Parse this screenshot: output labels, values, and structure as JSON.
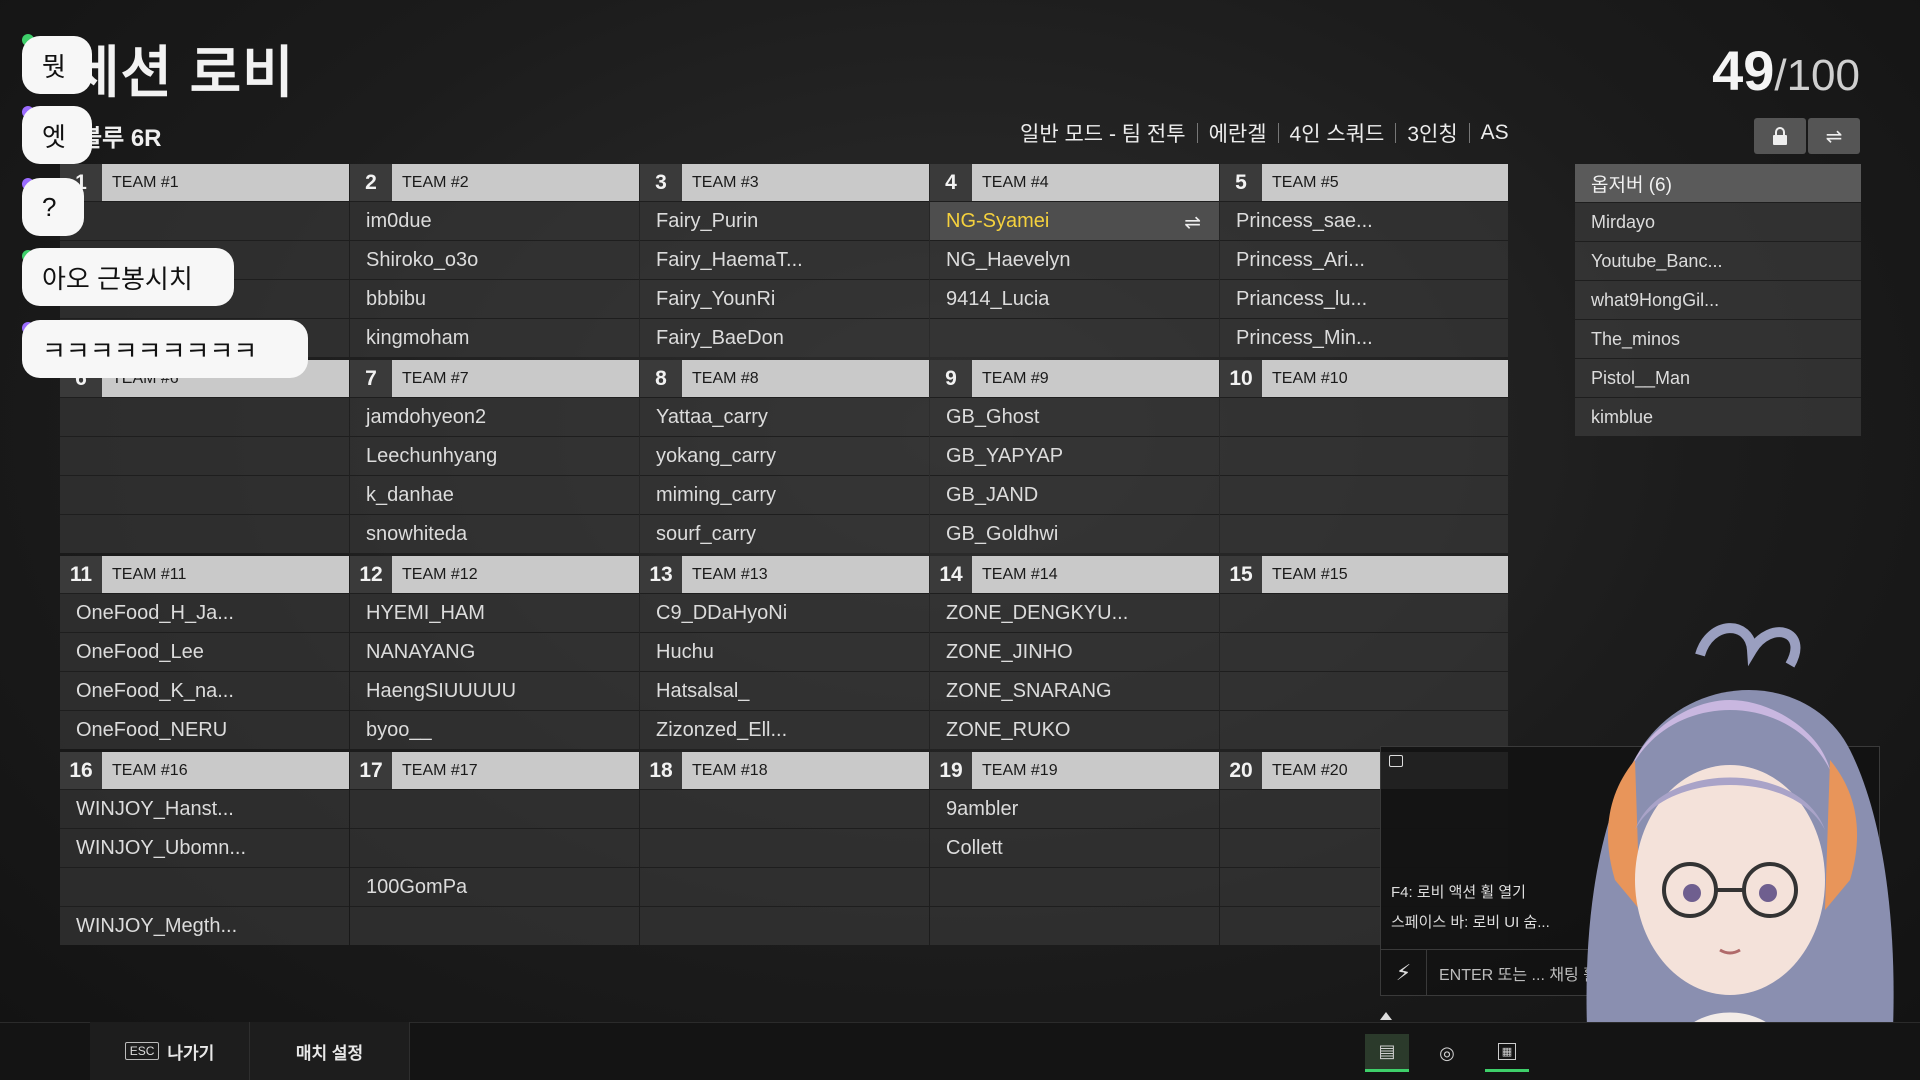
{
  "header": {
    "title": "세션 로비",
    "subtitle": "블루 6R",
    "player_count": "49",
    "player_max": "/100",
    "mode_items": [
      "일반 모드 - 팀 전투",
      "에란겔",
      "4인 스쿼드",
      "3인칭",
      "AS"
    ]
  },
  "teams": [
    {
      "num": "1",
      "name": "TEAM #1",
      "players": [
        "",
        "",
        "",
        ""
      ]
    },
    {
      "num": "2",
      "name": "TEAM #2",
      "players": [
        "im0due",
        "Shiroko_o3o",
        "bbbibu",
        "kingmoham"
      ]
    },
    {
      "num": "3",
      "name": "TEAM #3",
      "players": [
        "Fairy_Purin",
        "Fairy_HaemaT...",
        "Fairy_YounRi",
        "Fairy_BaeDon"
      ]
    },
    {
      "num": "4",
      "name": "TEAM #4",
      "players": [
        "NG-Syamei",
        "NG_Haevelyn",
        "9414_Lucia",
        ""
      ]
    },
    {
      "num": "5",
      "name": "TEAM #5",
      "players": [
        "Princess_sae...",
        "Princess_Ari...",
        "Priancess_lu...",
        "Princess_Min..."
      ]
    },
    {
      "num": "6",
      "name": "TEAM #6",
      "players": [
        "",
        "",
        "",
        ""
      ]
    },
    {
      "num": "7",
      "name": "TEAM #7",
      "players": [
        "jamdohyeon2",
        "Leechunhyang",
        "k_danhae",
        "snowhiteda"
      ]
    },
    {
      "num": "8",
      "name": "TEAM #8",
      "players": [
        "Yattaa_carry",
        "yokang_carry",
        "miming_carry",
        "sourf_carry"
      ]
    },
    {
      "num": "9",
      "name": "TEAM #9",
      "players": [
        "GB_Ghost",
        "GB_YAPYAP",
        "GB_JAND",
        "GB_Goldhwi"
      ]
    },
    {
      "num": "10",
      "name": "TEAM #10",
      "players": [
        "",
        "",
        "",
        ""
      ]
    },
    {
      "num": "11",
      "name": "TEAM #11",
      "players": [
        "OneFood_H_Ja...",
        "OneFood_Lee",
        "OneFood_K_na...",
        "OneFood_NERU"
      ]
    },
    {
      "num": "12",
      "name": "TEAM #12",
      "players": [
        "HYEMI_HAM",
        "NANAYANG",
        "HaengSIUUUUU",
        "byoo__"
      ]
    },
    {
      "num": "13",
      "name": "TEAM #13",
      "players": [
        "C9_DDaHyoNi",
        "Huchu",
        "Hatsalsal_",
        "Zizonzed_Ell..."
      ]
    },
    {
      "num": "14",
      "name": "TEAM #14",
      "players": [
        "ZONE_DENGKYU...",
        "ZONE_JINHO",
        "ZONE_SNARANG",
        "ZONE_RUKO"
      ]
    },
    {
      "num": "15",
      "name": "TEAM #15",
      "players": [
        "",
        "",
        "",
        ""
      ]
    },
    {
      "num": "16",
      "name": "TEAM #16",
      "players": [
        "WINJOY_Hanst...",
        "WINJOY_Ubomn...",
        "",
        "WINJOY_Megth..."
      ]
    },
    {
      "num": "17",
      "name": "TEAM #17",
      "players": [
        "",
        "",
        "100GomPa",
        ""
      ]
    },
    {
      "num": "18",
      "name": "TEAM #18",
      "players": [
        "",
        "",
        "",
        ""
      ]
    },
    {
      "num": "19",
      "name": "TEAM #19",
      "players": [
        "9ambler",
        "Collett",
        "",
        ""
      ]
    },
    {
      "num": "20",
      "name": "TEAM #20",
      "players": [
        "",
        "",
        "",
        ""
      ]
    }
  ],
  "highlight_player": "NG-Syamei",
  "observers": {
    "title": "옵저버 (6)",
    "items": [
      "Mirdayo",
      "Youtube_Banc...",
      "what9HongGil...",
      "The_minos",
      "Pistol__Man",
      "kimblue"
    ]
  },
  "chat_overlay": [
    "뭣",
    "엣",
    "?",
    "아오 근봉시치",
    "ㅋㅋㅋㅋㅋㅋㅋㅋㅋ"
  ],
  "chat_panel": {
    "hint1": "F4: 로비 액션 휠 열기",
    "hint2": "스페이스 바: 로비 UI 숨...",
    "input_placeholder": "ENTER 또는 ... 채팅 활성..."
  },
  "bottom_bar": {
    "esc_key": "ESC",
    "exit_label": "나가기",
    "match_settings_label": "매치 설정"
  },
  "colors": {
    "highlight_text": "#f5d13d",
    "header_bg": "#c9c9c9",
    "dot_green": "#3ecf6a",
    "dot_purple": "#9b6cff"
  }
}
